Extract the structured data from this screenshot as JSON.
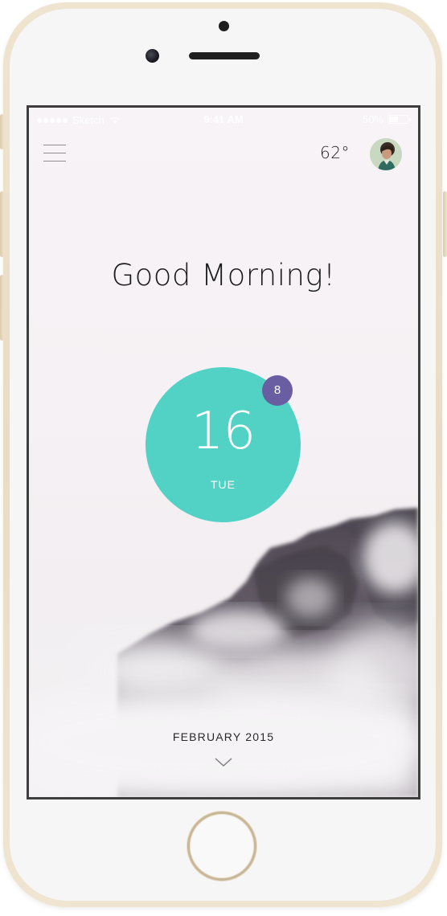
{
  "status_bar": {
    "carrier": "Sketch",
    "time": "9:41 AM",
    "battery": "50%",
    "battery_level": 0.5
  },
  "header": {
    "temperature": "62°"
  },
  "greeting": "Good Morning!",
  "date": {
    "day_number": "16",
    "weekday": "TUE",
    "event_count": "8"
  },
  "footer": {
    "month": "FEBRUARY 2015"
  },
  "colors": {
    "date_circle": "#52d2c4",
    "event_badge": "#6a5ea3",
    "phone_frame": "#efe4cf"
  },
  "icons": {
    "menu": "hamburger-menu-icon",
    "chevron": "chevron-down-icon",
    "wifi": "wifi-icon",
    "battery": "battery-icon"
  }
}
